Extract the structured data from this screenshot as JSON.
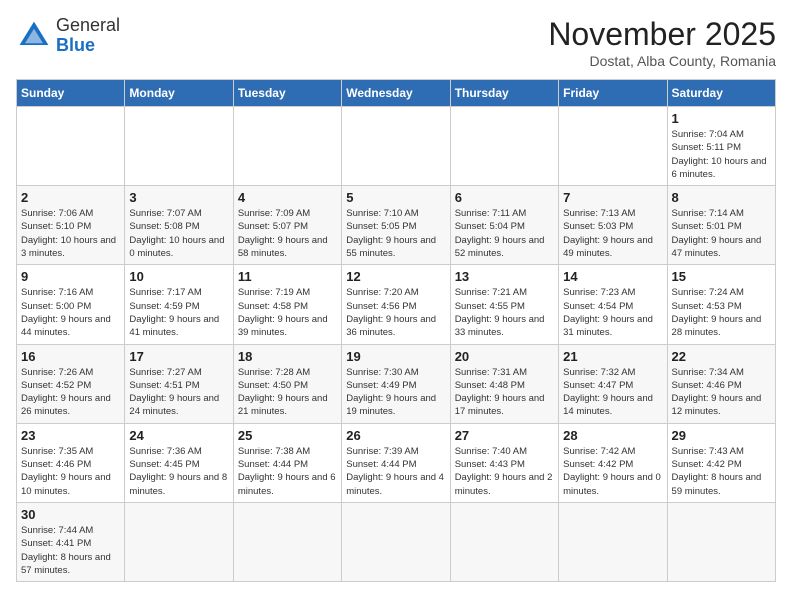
{
  "header": {
    "logo_general": "General",
    "logo_blue": "Blue",
    "month_title": "November 2025",
    "location": "Dostat, Alba County, Romania"
  },
  "days_of_week": [
    "Sunday",
    "Monday",
    "Tuesday",
    "Wednesday",
    "Thursday",
    "Friday",
    "Saturday"
  ],
  "weeks": [
    [
      {
        "day": "",
        "info": ""
      },
      {
        "day": "",
        "info": ""
      },
      {
        "day": "",
        "info": ""
      },
      {
        "day": "",
        "info": ""
      },
      {
        "day": "",
        "info": ""
      },
      {
        "day": "",
        "info": ""
      },
      {
        "day": "1",
        "info": "Sunrise: 7:04 AM\nSunset: 5:11 PM\nDaylight: 10 hours and 6 minutes."
      }
    ],
    [
      {
        "day": "2",
        "info": "Sunrise: 7:06 AM\nSunset: 5:10 PM\nDaylight: 10 hours and 3 minutes."
      },
      {
        "day": "3",
        "info": "Sunrise: 7:07 AM\nSunset: 5:08 PM\nDaylight: 10 hours and 0 minutes."
      },
      {
        "day": "4",
        "info": "Sunrise: 7:09 AM\nSunset: 5:07 PM\nDaylight: 9 hours and 58 minutes."
      },
      {
        "day": "5",
        "info": "Sunrise: 7:10 AM\nSunset: 5:05 PM\nDaylight: 9 hours and 55 minutes."
      },
      {
        "day": "6",
        "info": "Sunrise: 7:11 AM\nSunset: 5:04 PM\nDaylight: 9 hours and 52 minutes."
      },
      {
        "day": "7",
        "info": "Sunrise: 7:13 AM\nSunset: 5:03 PM\nDaylight: 9 hours and 49 minutes."
      },
      {
        "day": "8",
        "info": "Sunrise: 7:14 AM\nSunset: 5:01 PM\nDaylight: 9 hours and 47 minutes."
      }
    ],
    [
      {
        "day": "9",
        "info": "Sunrise: 7:16 AM\nSunset: 5:00 PM\nDaylight: 9 hours and 44 minutes."
      },
      {
        "day": "10",
        "info": "Sunrise: 7:17 AM\nSunset: 4:59 PM\nDaylight: 9 hours and 41 minutes."
      },
      {
        "day": "11",
        "info": "Sunrise: 7:19 AM\nSunset: 4:58 PM\nDaylight: 9 hours and 39 minutes."
      },
      {
        "day": "12",
        "info": "Sunrise: 7:20 AM\nSunset: 4:56 PM\nDaylight: 9 hours and 36 minutes."
      },
      {
        "day": "13",
        "info": "Sunrise: 7:21 AM\nSunset: 4:55 PM\nDaylight: 9 hours and 33 minutes."
      },
      {
        "day": "14",
        "info": "Sunrise: 7:23 AM\nSunset: 4:54 PM\nDaylight: 9 hours and 31 minutes."
      },
      {
        "day": "15",
        "info": "Sunrise: 7:24 AM\nSunset: 4:53 PM\nDaylight: 9 hours and 28 minutes."
      }
    ],
    [
      {
        "day": "16",
        "info": "Sunrise: 7:26 AM\nSunset: 4:52 PM\nDaylight: 9 hours and 26 minutes."
      },
      {
        "day": "17",
        "info": "Sunrise: 7:27 AM\nSunset: 4:51 PM\nDaylight: 9 hours and 24 minutes."
      },
      {
        "day": "18",
        "info": "Sunrise: 7:28 AM\nSunset: 4:50 PM\nDaylight: 9 hours and 21 minutes."
      },
      {
        "day": "19",
        "info": "Sunrise: 7:30 AM\nSunset: 4:49 PM\nDaylight: 9 hours and 19 minutes."
      },
      {
        "day": "20",
        "info": "Sunrise: 7:31 AM\nSunset: 4:48 PM\nDaylight: 9 hours and 17 minutes."
      },
      {
        "day": "21",
        "info": "Sunrise: 7:32 AM\nSunset: 4:47 PM\nDaylight: 9 hours and 14 minutes."
      },
      {
        "day": "22",
        "info": "Sunrise: 7:34 AM\nSunset: 4:46 PM\nDaylight: 9 hours and 12 minutes."
      }
    ],
    [
      {
        "day": "23",
        "info": "Sunrise: 7:35 AM\nSunset: 4:46 PM\nDaylight: 9 hours and 10 minutes."
      },
      {
        "day": "24",
        "info": "Sunrise: 7:36 AM\nSunset: 4:45 PM\nDaylight: 9 hours and 8 minutes."
      },
      {
        "day": "25",
        "info": "Sunrise: 7:38 AM\nSunset: 4:44 PM\nDaylight: 9 hours and 6 minutes."
      },
      {
        "day": "26",
        "info": "Sunrise: 7:39 AM\nSunset: 4:44 PM\nDaylight: 9 hours and 4 minutes."
      },
      {
        "day": "27",
        "info": "Sunrise: 7:40 AM\nSunset: 4:43 PM\nDaylight: 9 hours and 2 minutes."
      },
      {
        "day": "28",
        "info": "Sunrise: 7:42 AM\nSunset: 4:42 PM\nDaylight: 9 hours and 0 minutes."
      },
      {
        "day": "29",
        "info": "Sunrise: 7:43 AM\nSunset: 4:42 PM\nDaylight: 8 hours and 59 minutes."
      }
    ],
    [
      {
        "day": "30",
        "info": "Sunrise: 7:44 AM\nSunset: 4:41 PM\nDaylight: 8 hours and 57 minutes."
      },
      {
        "day": "",
        "info": ""
      },
      {
        "day": "",
        "info": ""
      },
      {
        "day": "",
        "info": ""
      },
      {
        "day": "",
        "info": ""
      },
      {
        "day": "",
        "info": ""
      },
      {
        "day": "",
        "info": ""
      }
    ]
  ]
}
